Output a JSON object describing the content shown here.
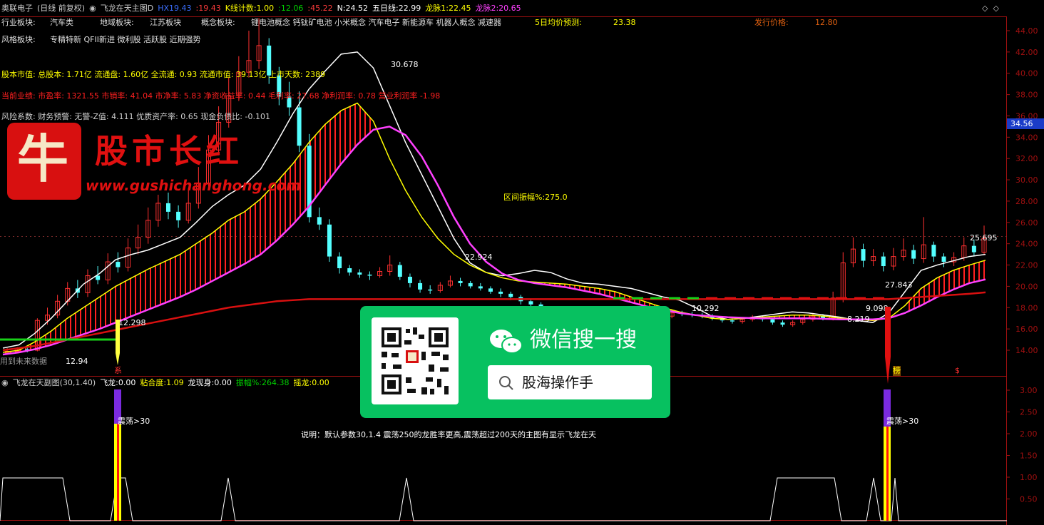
{
  "header": {
    "stock_name": "奥联电子",
    "period_mode": "(日线 前复权)",
    "indicator_name": "飞龙在天主图D",
    "items": [
      {
        "label": "HX",
        "value": "19.43",
        "color": "#3b6fff"
      },
      {
        "label": ":",
        "value": "19.43",
        "color": "#ff3b3b"
      },
      {
        "label": "K线计数:",
        "value": "1.00",
        "color": "#ffff00"
      },
      {
        "label": ":",
        "value": "12.06",
        "color": "#00d000"
      },
      {
        "label": ":",
        "value": "45.22",
        "color": "#ff3b3b"
      },
      {
        "label": "N:",
        "value": "24.52",
        "color": "#ffffff"
      },
      {
        "label": "五日线:",
        "value": "22.99",
        "color": "#ffffff"
      },
      {
        "label": "龙脉1:",
        "value": "22.45",
        "color": "#ffff00"
      },
      {
        "label": "龙脉2:",
        "value": "20.65",
        "color": "#ff40ff"
      }
    ]
  },
  "info": {
    "industry_label": "行业板块:",
    "industry_value": "汽车类",
    "region_label": "地域板块:",
    "region_value": "江苏板块",
    "concept_label": "概念板块:",
    "concept_value": "锂电池概念 钙钛矿电池 小米概念 汽车电子 新能源车 机器人概念 减速器",
    "forecast_label": "5日均价预测:",
    "forecast_value": "23.38",
    "issue_label": "发行价格:",
    "issue_value": "12.80",
    "style_label": "风格板块:",
    "style_value": "专精特新 QFII新进 微利股 活跃股 近期强势",
    "equity_line": "股本市值: 总股本: 1.71亿 流通盘: 1.60亿 全流通: 0.93 流通市值: 39.13亿 上市天数: 2389",
    "perf_line": "当前业绩: 市盈率: 1321.55 市销率: 41.04 市净率: 5.83 净资收益率: 0.44 毛利率: 27.68 净利润率: 0.78 营业利润率 -1.98",
    "risk_line": "风险系数: 财务预警: 无警-Z值: 4.111 优质资产率: 0.65 现金负债比: -0.101"
  },
  "logo": {
    "char": "牛",
    "text": "股市长红",
    "url": "www.gushichanghong.com"
  },
  "wechat": {
    "title": "微信搜一搜",
    "search_text": "股海操作手"
  },
  "annotations": {
    "range_amplitude": "区间振幅%:275.0",
    "future_data": "用到未来数据",
    "right_price_tag": "34.56",
    "tag_xi": "系",
    "tag_bang": "榜",
    "tag_dollar": "$"
  },
  "sub": {
    "name": "飞龙在天副图(30,1.40)",
    "items": [
      {
        "label": "飞龙:",
        "value": "0.00",
        "color": "#ffffff"
      },
      {
        "label": "粘合度:",
        "value": "1.09",
        "color": "#ffff00"
      },
      {
        "label": "龙现身:",
        "value": "0.00",
        "color": "#ffffff"
      },
      {
        "label": "振幅%:",
        "value": "264.38",
        "color": "#00d000"
      },
      {
        "label": "摇龙:",
        "value": "0.00",
        "color": "#ffff00"
      }
    ],
    "note": "说明：默认参数30,1.4 震荡250的龙胜率更高,震荡超过200天的主图有显示飞龙在天",
    "osc_label": "震荡>30"
  },
  "chart_data": [
    {
      "type": "candlestick",
      "title": "飞龙在天主图D",
      "y_ticks": [
        "44.00",
        "42.00",
        "40.00",
        "38.00",
        "36.00",
        "34.00",
        "32.00",
        "30.00",
        "28.00",
        "26.00",
        "24.00",
        "22.00",
        "20.00",
        "18.00",
        "16.00",
        "14.00"
      ],
      "ylim": [
        13.0,
        45.5
      ],
      "point_labels": [
        "30.678",
        "22.924",
        "10.292",
        "25.695",
        "27.843",
        "12.94",
        "9.098",
        "8.219",
        "12.298"
      ],
      "series": [
        {
          "name": "五日线",
          "color": "#ffffff",
          "values": [
            14.2,
            14.5,
            15.6,
            17.0,
            18.6,
            20.2,
            21.2,
            22.5,
            23.0,
            23.4,
            24.0,
            24.6,
            26.0,
            27.5,
            28.6,
            29.5,
            31.0,
            33.5,
            36.2,
            38.5,
            40.2,
            41.8,
            42.0,
            40.5,
            37.0,
            33.5,
            30.5,
            27.5,
            24.5,
            22.2,
            21.3,
            21.0,
            21.2,
            21.5,
            21.3,
            20.7,
            20.3,
            20.2,
            20.0,
            19.8,
            19.4,
            19.0,
            18.7,
            18.0,
            17.2,
            16.9,
            17.0,
            17.2,
            17.4,
            17.6,
            17.5,
            17.3,
            17.1,
            16.8,
            16.6,
            17.5,
            19.5,
            21.5,
            22.0,
            22.4,
            22.8,
            23.0
          ]
        },
        {
          "name": "龙脉1",
          "color": "#ffff00",
          "values": [
            13.8,
            14.0,
            14.8,
            15.8,
            17.0,
            18.0,
            19.0,
            20.0,
            20.8,
            21.6,
            22.3,
            23.0,
            24.0,
            25.0,
            26.2,
            27.0,
            28.2,
            29.8,
            31.5,
            33.5,
            35.2,
            36.5,
            37.2,
            35.5,
            32.0,
            29.0,
            26.5,
            24.5,
            23.0,
            22.0,
            21.3,
            20.8,
            20.5,
            20.4,
            20.3,
            20.2,
            20.0,
            19.8,
            19.5,
            19.0,
            18.5,
            18.0,
            17.6,
            17.3,
            17.0,
            16.9,
            17.0,
            17.1,
            17.2,
            17.3,
            17.3,
            17.2,
            17.0,
            16.9,
            16.8,
            17.0,
            18.2,
            19.8,
            20.8,
            21.5,
            22.0,
            22.45
          ]
        },
        {
          "name": "龙脉2",
          "color": "#ff40ff",
          "values": [
            13.6,
            13.8,
            14.1,
            14.5,
            15.0,
            15.5,
            16.0,
            16.6,
            17.2,
            17.8,
            18.4,
            19.0,
            19.7,
            20.5,
            21.3,
            22.1,
            23.0,
            24.3,
            25.8,
            27.5,
            29.5,
            31.5,
            33.3,
            34.7,
            35.0,
            34.2,
            32.2,
            29.5,
            26.5,
            24.0,
            22.3,
            21.2,
            20.6,
            20.3,
            20.1,
            19.9,
            19.6,
            19.3,
            18.9,
            18.5,
            18.1,
            17.8,
            17.5,
            17.3,
            17.2,
            17.1,
            17.05,
            17.0,
            17.0,
            17.0,
            17.0,
            16.95,
            16.9,
            16.9,
            16.9,
            17.0,
            17.5,
            18.2,
            19.0,
            19.7,
            20.3,
            20.65
          ]
        },
        {
          "name": "HX",
          "color": "#d81010",
          "values": [
            14.0,
            14.2,
            14.4,
            14.7,
            15.0,
            15.3,
            15.6,
            15.9,
            16.2,
            16.5,
            16.8,
            17.1,
            17.4,
            17.7,
            18.0,
            18.2,
            18.4,
            18.6,
            18.7,
            18.8,
            18.8,
            18.8,
            18.8,
            18.8,
            18.8,
            18.8,
            18.8,
            18.8,
            18.8,
            18.8,
            18.8,
            18.8,
            18.8,
            18.8,
            18.8,
            18.8,
            18.8,
            18.8,
            18.8,
            18.8,
            18.8,
            18.8,
            18.8,
            18.8,
            18.8,
            18.8,
            18.8,
            18.8,
            18.8,
            18.8,
            18.8,
            18.8,
            18.8,
            18.8,
            18.8,
            18.8,
            18.9,
            19.0,
            19.1,
            19.2,
            19.3,
            19.43
          ]
        }
      ],
      "candles": [
        [
          13.8,
          13.9,
          14.2,
          13.6
        ],
        [
          13.9,
          14.1,
          14.3,
          13.7
        ],
        [
          14.1,
          14.0,
          14.4,
          13.8
        ],
        [
          14.0,
          16.8,
          17.0,
          13.9
        ],
        [
          16.8,
          17.3,
          18.0,
          16.4
        ],
        [
          17.3,
          18.6,
          19.2,
          17.0
        ],
        [
          18.6,
          19.8,
          20.4,
          18.2
        ],
        [
          19.8,
          19.4,
          20.6,
          18.9
        ],
        [
          19.4,
          21.0,
          21.6,
          19.0
        ],
        [
          21.0,
          20.6,
          21.9,
          20.2
        ],
        [
          20.6,
          22.3,
          23.1,
          20.2
        ],
        [
          22.3,
          21.8,
          23.2,
          21.3
        ],
        [
          21.8,
          23.6,
          24.5,
          21.4
        ],
        [
          23.6,
          24.6,
          25.8,
          23.0
        ],
        [
          24.6,
          26.2,
          27.4,
          24.0
        ],
        [
          26.2,
          27.8,
          28.6,
          25.6
        ],
        [
          27.8,
          27.0,
          28.8,
          26.3
        ],
        [
          27.0,
          26.2,
          27.6,
          25.5
        ],
        [
          26.2,
          27.8,
          29.2,
          25.9
        ],
        [
          27.8,
          29.7,
          31.2,
          27.3
        ],
        [
          29.7,
          32.8,
          34.2,
          29.2
        ],
        [
          32.8,
          35.4,
          36.9,
          32.3
        ],
        [
          35.4,
          37.9,
          39.6,
          34.9
        ],
        [
          37.9,
          40.1,
          41.6,
          37.4
        ],
        [
          40.1,
          41.2,
          44.0,
          39.6
        ],
        [
          41.2,
          42.6,
          45.2,
          40.4
        ],
        [
          42.6,
          39.8,
          43.3,
          39.0
        ],
        [
          39.8,
          37.8,
          40.6,
          37.0
        ],
        [
          37.8,
          36.8,
          39.2,
          36.0
        ],
        [
          36.8,
          33.2,
          38.3,
          32.6
        ],
        [
          33.2,
          26.5,
          34.3,
          26.0
        ],
        [
          26.5,
          25.8,
          27.4,
          25.3
        ],
        [
          25.8,
          22.8,
          26.3,
          22.3
        ],
        [
          22.8,
          21.7,
          23.2,
          21.2
        ],
        [
          21.7,
          21.3,
          22.0,
          21.0
        ],
        [
          21.3,
          21.1,
          21.6,
          20.8
        ],
        [
          21.1,
          21.0,
          21.4,
          20.6
        ],
        [
          21.0,
          21.4,
          21.8,
          20.8
        ],
        [
          21.4,
          22.0,
          22.9,
          21.0
        ],
        [
          22.0,
          20.9,
          22.3,
          20.6
        ],
        [
          20.9,
          20.3,
          21.2,
          19.9
        ],
        [
          20.3,
          19.7,
          20.6,
          19.4
        ],
        [
          19.7,
          19.6,
          20.1,
          19.3
        ],
        [
          19.6,
          20.1,
          20.4,
          19.4
        ],
        [
          20.1,
          20.5,
          21.0,
          19.9
        ],
        [
          20.5,
          20.3,
          20.8,
          20.0
        ],
        [
          20.3,
          20.0,
          20.5,
          19.8
        ],
        [
          20.0,
          19.8,
          20.3,
          19.6
        ],
        [
          19.8,
          19.5,
          20.0,
          19.3
        ],
        [
          19.5,
          19.3,
          19.8,
          19.0
        ],
        [
          19.3,
          19.0,
          19.5,
          18.7
        ],
        [
          19.0,
          18.6,
          19.2,
          18.3
        ],
        [
          18.6,
          18.3,
          18.8,
          18.0
        ],
        [
          18.3,
          17.8,
          18.5,
          17.5
        ],
        [
          17.8,
          17.2,
          18.0,
          16.9
        ],
        [
          17.2,
          16.9,
          17.4,
          16.6
        ],
        [
          16.9,
          16.6,
          17.1,
          16.4
        ],
        [
          16.6,
          16.5,
          16.8,
          16.3
        ],
        [
          16.5,
          16.8,
          17.0,
          16.3
        ],
        [
          16.8,
          17.5,
          17.8,
          16.6
        ],
        [
          17.5,
          16.5,
          17.6,
          16.2
        ],
        [
          16.5,
          16.4,
          16.7,
          16.2
        ],
        [
          16.4,
          16.7,
          16.9,
          16.3
        ],
        [
          16.7,
          16.8,
          17.0,
          16.5
        ],
        [
          16.8,
          17.0,
          17.2,
          16.6
        ],
        [
          17.0,
          17.2,
          17.4,
          16.8
        ],
        [
          17.2,
          17.5,
          17.8,
          17.0
        ],
        [
          17.5,
          17.4,
          17.7,
          17.2
        ],
        [
          17.4,
          17.3,
          17.6,
          17.1
        ],
        [
          17.3,
          17.2,
          17.5,
          17.0
        ],
        [
          17.2,
          17.0,
          17.4,
          16.8
        ],
        [
          17.0,
          16.8,
          17.2,
          16.6
        ],
        [
          16.8,
          16.7,
          17.0,
          16.5
        ],
        [
          16.7,
          16.9,
          17.1,
          16.5
        ],
        [
          16.9,
          17.1,
          17.3,
          16.7
        ],
        [
          17.1,
          16.9,
          17.2,
          16.7
        ],
        [
          16.9,
          16.6,
          17.0,
          16.4
        ],
        [
          16.6,
          16.4,
          16.8,
          16.2
        ],
        [
          16.4,
          16.6,
          16.8,
          16.2
        ],
        [
          16.6,
          16.9,
          17.1,
          16.4
        ],
        [
          16.9,
          17.2,
          17.5,
          16.7
        ],
        [
          17.2,
          17.0,
          17.4,
          16.8
        ],
        [
          17.0,
          18.9,
          19.5,
          16.8
        ],
        [
          18.9,
          22.2,
          23.2,
          18.5
        ],
        [
          22.2,
          23.5,
          24.6,
          21.8
        ],
        [
          23.5,
          22.4,
          24.0,
          21.8
        ],
        [
          22.4,
          22.8,
          23.5,
          21.9
        ],
        [
          22.8,
          21.9,
          23.2,
          21.4
        ],
        [
          21.9,
          22.8,
          23.6,
          21.5
        ],
        [
          22.8,
          23.4,
          24.5,
          22.4
        ],
        [
          23.4,
          22.6,
          23.9,
          22.1
        ],
        [
          22.6,
          23.9,
          26.5,
          22.2
        ],
        [
          23.9,
          22.8,
          24.2,
          22.3
        ],
        [
          22.8,
          22.3,
          23.1,
          21.8
        ],
        [
          22.3,
          22.7,
          23.2,
          21.9
        ],
        [
          22.7,
          23.8,
          24.6,
          22.4
        ],
        [
          23.8,
          23.2,
          24.4,
          22.8
        ],
        [
          23.2,
          24.5,
          25.7,
          23.0
        ]
      ]
    },
    {
      "type": "line",
      "title": "飞龙在天副图(30,1.40)",
      "y_ticks": [
        "3.00",
        "2.50",
        "2.00",
        "1.50",
        "1.00",
        "0.50"
      ],
      "ylim": [
        0,
        3.2
      ]
    }
  ]
}
